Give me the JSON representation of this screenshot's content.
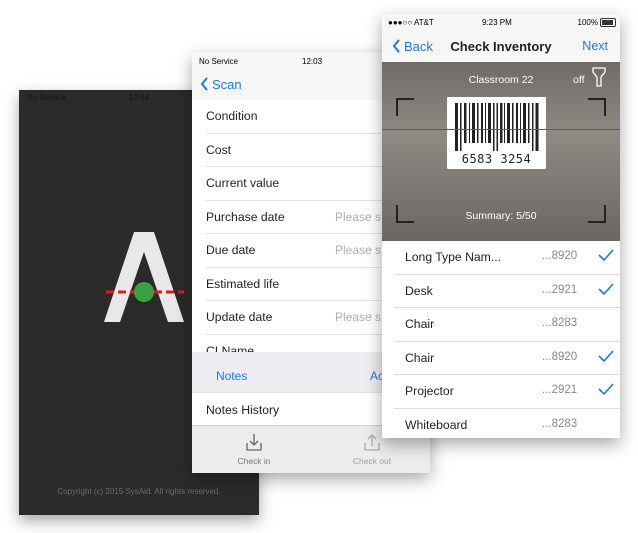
{
  "splash": {
    "status_carrier": "No Service",
    "status_time": "12:04",
    "copyright": "Copyright (c) 2015 SysAid. All rights reserved.",
    "logo_icon": "sysaid-logo-icon"
  },
  "details": {
    "status_carrier": "No Service",
    "status_time": "12:03",
    "back_label": "Scan",
    "fields": [
      {
        "label": "Condition",
        "placeholder": ""
      },
      {
        "label": "Cost",
        "placeholder": ""
      },
      {
        "label": "Current value",
        "placeholder": ""
      },
      {
        "label": "Purchase date",
        "placeholder": "Please s"
      },
      {
        "label": "Due date",
        "placeholder": "Please s"
      },
      {
        "label": "Estimated life",
        "placeholder": ""
      },
      {
        "label": "Update date",
        "placeholder": "Please s"
      },
      {
        "label": "CI Name",
        "placeholder": ""
      }
    ],
    "notes_label": "Notes",
    "notes_action": "Ac",
    "notes_history": "Notes History",
    "tabs": [
      {
        "label": "Check in",
        "icon": "download-icon"
      },
      {
        "label": "Check out",
        "icon": "upload-icon"
      }
    ]
  },
  "inventory": {
    "status_carrier": "AT&T",
    "status_time": "9:23 PM",
    "status_battery": "100%",
    "back_label": "Back",
    "title": "Check Inventory",
    "next_label": "Next",
    "scanner": {
      "location": "Classroom 22",
      "flash_state": "off",
      "barcode_left": "6583",
      "barcode_right": "3254",
      "summary": "Summary: 5/50"
    },
    "items": [
      {
        "name": "Long Type Nam...",
        "id": "...8920",
        "checked": true
      },
      {
        "name": "Desk",
        "id": "...2921",
        "checked": true
      },
      {
        "name": "Chair",
        "id": "...8283",
        "checked": false
      },
      {
        "name": "Chair",
        "id": "...8920",
        "checked": true
      },
      {
        "name": "Projector",
        "id": "...2921",
        "checked": true
      },
      {
        "name": "Whiteboard",
        "id": "...8283",
        "checked": false
      }
    ],
    "accent_color": "#1b7ad6"
  }
}
